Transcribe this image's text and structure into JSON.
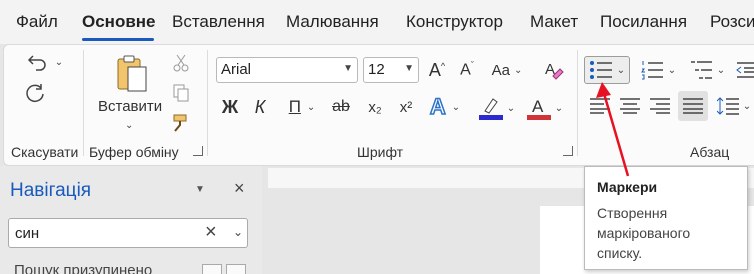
{
  "tabs": [
    "Файл",
    "Основне",
    "Вставлення",
    "Малювання",
    "Конструктор",
    "Макет",
    "Посилання",
    "Розси"
  ],
  "ribbon": {
    "undo_group_label": "Скасувати",
    "clipboard": {
      "paste_label": "Вставити",
      "group_label": "Буфер обміну"
    },
    "font": {
      "name": "Arial",
      "size": "12",
      "group_label": "Шрифт",
      "change_case_label": "Aa",
      "bold": "Ж",
      "italic": "К",
      "underline": "П",
      "strikethrough": "ab",
      "subscript": "x₂",
      "superscript": "x²"
    },
    "paragraph": {
      "group_label": "Абзац"
    }
  },
  "colors": {
    "accent": "#185abd",
    "highlight": "#2b2bd0",
    "font_color": "#d13438",
    "arrow": "#e81123"
  },
  "navigation": {
    "title": "Навігація",
    "search_value": "син",
    "partial_item": "Пошук призупинено"
  },
  "tooltip": {
    "title": "Маркери",
    "description": "Створення маркірованого списку."
  }
}
